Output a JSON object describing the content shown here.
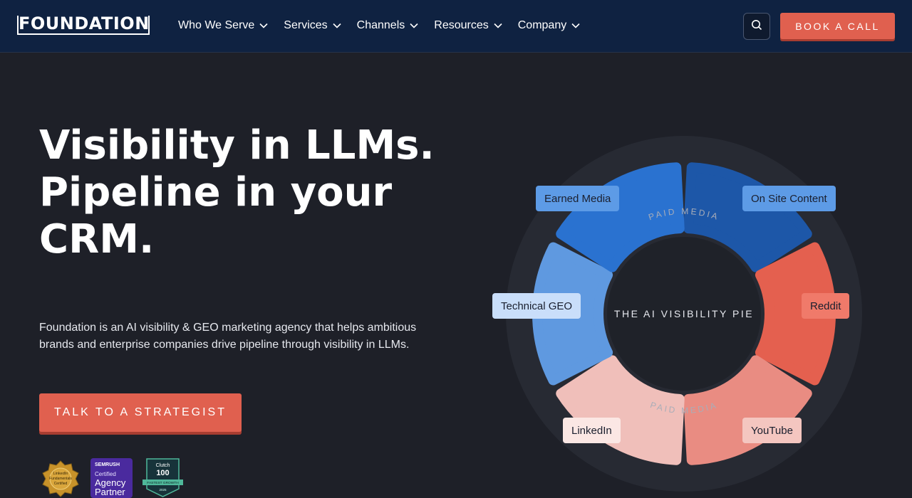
{
  "nav": {
    "logo": "FOUNDATION",
    "items": [
      {
        "label": "Who We Serve"
      },
      {
        "label": "Services"
      },
      {
        "label": "Channels"
      },
      {
        "label": "Resources"
      },
      {
        "label": "Company"
      }
    ],
    "search_icon": "search-icon",
    "cta": "BOOK A CALL"
  },
  "hero": {
    "title_line1": "Visibility in LLMs.",
    "title_line2": "Pipeline in your",
    "title_line3": "CRM.",
    "description": "Foundation is an AI visibility & GEO marketing agency that helps ambitious brands and enterprise companies drive pipeline through visibility in LLMs.",
    "cta": "TALK TO A STRATEGIST"
  },
  "badges": {
    "linkedin": {
      "line1": "LinkedIn",
      "line2": "Fundamentals",
      "line3": "Certified"
    },
    "semrush": {
      "brand": "SEMRUSH",
      "line1": "Certified",
      "line2": "Agency",
      "line3": "Partner"
    },
    "clutch": {
      "brand": "Clutch",
      "number": "100",
      "line": "FASTEST GROWTH",
      "year": "2025"
    }
  },
  "pie": {
    "center_label": "THE AI VISIBILITY PIE",
    "outer_top": "PAID MEDIA",
    "outer_bottom": "PAID MEDIA",
    "segments": [
      {
        "label": "Earned Media",
        "color": "#2a72d0"
      },
      {
        "label": "On Site Content",
        "color": "#1d57a8"
      },
      {
        "label": "Reddit",
        "color": "#e4604f"
      },
      {
        "label": "YouTube",
        "color": "#e98c82"
      },
      {
        "label": "LinkedIn",
        "color": "#f0bfba"
      },
      {
        "label": "Technical GEO",
        "color": "#5f99e0"
      }
    ]
  },
  "colors": {
    "nav_bg": "#0f2241",
    "page_bg": "#1e2028",
    "accent": "#e0604f"
  }
}
